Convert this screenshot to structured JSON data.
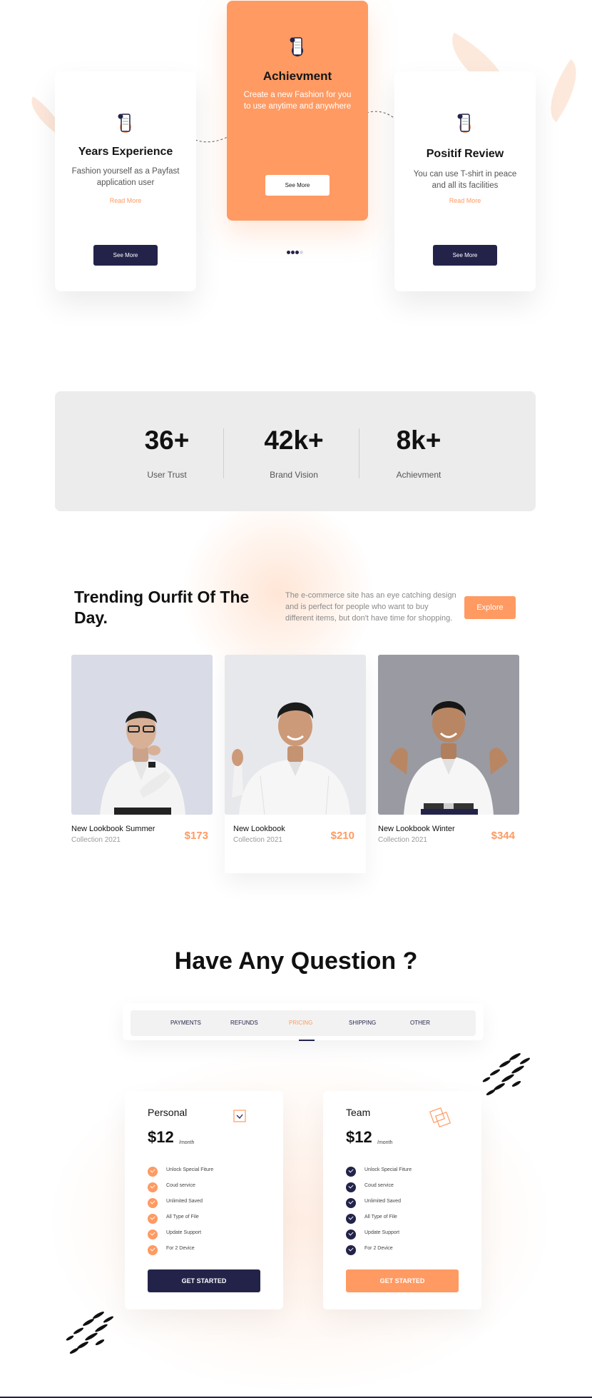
{
  "colors": {
    "accent": "#ff9a62",
    "navy": "#23234a",
    "panel": "#ececec"
  },
  "feature_cards": [
    {
      "icon": "mobile-app-icon",
      "title": "Years Experience",
      "text": "Fashion yourself as a Payfast application user",
      "link": "Read More",
      "button": "See More"
    },
    {
      "icon": "mobile-app-icon",
      "title": "Achievment",
      "text": "Create a new Fashion for you to use anytime and anywhere",
      "button": "See More"
    },
    {
      "icon": "mobile-app-icon",
      "title": "Positif Review",
      "text": "You can use T-shirt in peace and all its facilities",
      "link": "Read More",
      "button": "See More"
    }
  ],
  "stats": [
    {
      "value": "36+",
      "label": "User Trust"
    },
    {
      "value": "42k+",
      "label": "Brand  Vision"
    },
    {
      "value": "8k+",
      "label": "Achievment"
    }
  ],
  "trending": {
    "title": "Trending Ourfit Of The Day.",
    "description": "The e-commerce site has an eye catching design and is perfect for people who want to buy different items, but don't have time for shopping.",
    "button": "Explore",
    "products": [
      {
        "name": "New Lookbook Summer",
        "subtitle": "Collection 2021",
        "price": "$173"
      },
      {
        "name": "New Lookbook",
        "subtitle": "Collection 2021",
        "price": "$210"
      },
      {
        "name": "New Lookbook Winter",
        "subtitle": "Collection 2021",
        "price": "$344"
      }
    ]
  },
  "faq": {
    "title": "Have Any Question ?",
    "tabs": [
      "PAYMENTS",
      "REFUNDS",
      "PRICING",
      "SHIPPING",
      "OTHER"
    ],
    "active_tab": "PRICING"
  },
  "plans": [
    {
      "name": "Personal",
      "price": "$12",
      "period": "/month",
      "icon": "check-box-icon",
      "features": [
        "Unlock Special Fiture",
        "Coud service",
        "Unlimited Saved",
        "All Type of File",
        "Update Support",
        "For 2 Device"
      ],
      "button": "GET STARTED"
    },
    {
      "name": "Team",
      "price": "$12",
      "period": "/month",
      "icon": "stacked-squares-icon",
      "features": [
        "Unlock Special Fiture",
        "Coud service",
        "Unlimited Saved",
        "All Type of File",
        "Update Support",
        "For 2 Device"
      ],
      "button": "GET STARTED"
    }
  ]
}
